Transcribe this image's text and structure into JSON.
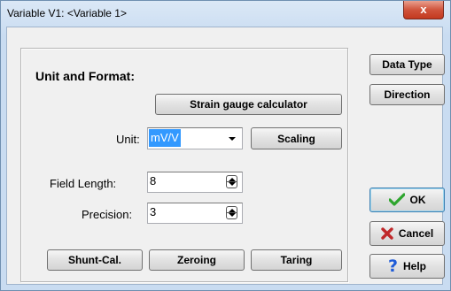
{
  "window": {
    "title": "Variable V1: <Variable 1>",
    "close_glyph": "x"
  },
  "group": {
    "heading": "Unit and Format:",
    "strain_button": "Strain gauge calculator",
    "unit_label": "Unit:",
    "unit_value": "mV/V",
    "scaling_button": "Scaling",
    "field_length_label": "Field Length:",
    "field_length_value": "8",
    "precision_label": "Precision:",
    "precision_value": "3",
    "shunt_button": "Shunt-Cal.",
    "zeroing_button": "Zeroing",
    "taring_button": "Taring"
  },
  "side": {
    "data_type_button": "Data Type",
    "direction_button": "Direction",
    "ok_button": "OK",
    "cancel_button": "Cancel",
    "help_button": "Help"
  },
  "icons": {
    "ok": "check-icon",
    "cancel": "x-icon",
    "help": "question-icon"
  },
  "colors": {
    "selection": "#3399ff",
    "ok_check": "#2ea52e",
    "cancel_x": "#c0282a",
    "help_q": "#1e5bd8"
  }
}
